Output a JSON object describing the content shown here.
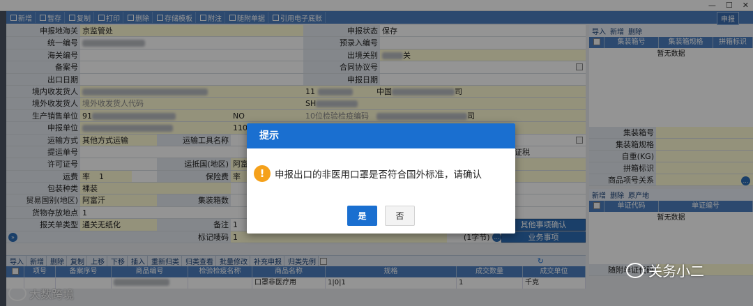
{
  "window": {
    "minimize": "—",
    "maximize": "☐",
    "close": "✕"
  },
  "toolbar": {
    "buttons": [
      "新增",
      "暂存",
      "复制",
      "打印",
      "删除",
      "存储模板",
      "附注",
      "随附单据",
      "引用电子底账"
    ],
    "declare": "申报"
  },
  "form": {
    "customs_label": "申报地海关",
    "customs_value": "京监管处",
    "status_label": "申报状态",
    "status_value": "保存",
    "unified_label": "统一编号",
    "preentry_label": "预录入编号",
    "port_label": "海关编号",
    "exit_label": "出境关别",
    "exit_value": "关",
    "record_label": "备案号",
    "contract_label": "合同协议号",
    "exportdate_label": "出口日期",
    "declaredate_label": "申报日期",
    "consignee_label": "境内收发货人",
    "consignee_code": "11",
    "consignee_name": "中国",
    "consignee_tail": "司",
    "overseas_label": "境外收发货人",
    "overseas_placeholder": "境外收发货人代码",
    "overseas_value": "SH",
    "producer_label": "生产销售单位",
    "producer_code": "91",
    "producer_flag": "NO",
    "producer_hint": "10位检验检疫编码",
    "producer_tail": "司",
    "agent_label": "申报单位",
    "agent_code": "1108",
    "transport_label": "运输方式",
    "transport_value": "其他方式运输",
    "vehicle_label": "运输工具名称",
    "bill_label": "提运单号",
    "tax_tail": "证税",
    "license_label": "许可证号",
    "dest_label": "运抵国(地区)",
    "dest_value": "阿富",
    "freight_label": "运费",
    "freight_type": "率",
    "freight_value": "1",
    "insurance_label": "保险费",
    "insurance_type": "率",
    "pack_label": "包装种类",
    "pack_value": "裸装",
    "trade_label": "贸易国别(地区)",
    "trade_value": "阿富汗",
    "box_label": "集装箱数",
    "storage_label": "货物存放地点",
    "storage_value": "1",
    "doc_label": "报关单类型",
    "doc_value": "通关无纸化",
    "remark_label": "备注",
    "remark_value": "1",
    "other_btn": "其他事项确认",
    "mark_label": "标记唛码",
    "mark_value": "1",
    "mark_count": "(1字节)",
    "business_btn": "业务事项"
  },
  "grid": {
    "toolbar": [
      "导入",
      "新增",
      "删除",
      "复制",
      "上移",
      "下移",
      "插入",
      "重新归类",
      "归类查看",
      "批量修改",
      "补充申报",
      "归类先例"
    ],
    "headers": [
      "项号",
      "备案序号",
      "商品编号",
      "检验检疫名称",
      "商品名称",
      "规格",
      "成交数量",
      "成交单位"
    ],
    "row": [
      "",
      "",
      "",
      "",
      "口罩非医疗用",
      "1|0|1",
      "1",
      "千克"
    ]
  },
  "right": {
    "tool1": [
      "导入",
      "新增",
      "删除"
    ],
    "head1": [
      "集装箱号",
      "集装箱规格",
      "拼箱标识"
    ],
    "nodata": "暂无数据",
    "fields": [
      "集装箱号",
      "集装箱规格",
      "自重(KG)",
      "拼箱标识",
      "商品项号关系"
    ],
    "tool2": [
      "新增",
      "删除",
      "原产地"
    ],
    "head2": [
      "单证代码",
      "单证编号"
    ],
    "nodata2": "暂无数据",
    "attach_label": "随附单证代码"
  },
  "modal": {
    "title": "提示",
    "message": "申报出口的非医用口罩是否符合国外标准，请确认",
    "yes": "是",
    "no": "否"
  },
  "watermarks": {
    "left": "大数跨境",
    "right": "关务小二"
  },
  "colors": {
    "accent": "#1a6fd0",
    "toolbar": "#4c7fc0",
    "warn": "#f5a11b"
  }
}
